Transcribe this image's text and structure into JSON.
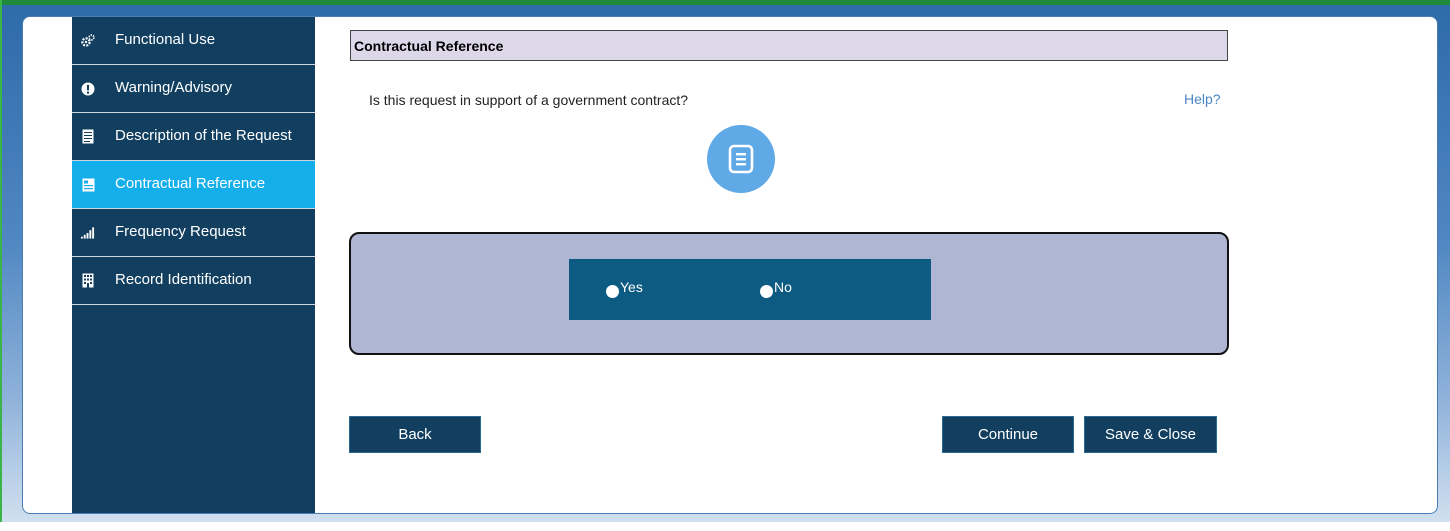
{
  "sidebar": {
    "items": [
      {
        "label": "Functional Use",
        "icon": "gears-icon",
        "active": false
      },
      {
        "label": "Warning/Advisory",
        "icon": "exclamation-icon",
        "active": false
      },
      {
        "label": "Description of the Request",
        "icon": "document-lines-icon",
        "active": false
      },
      {
        "label": "Contractual Reference",
        "icon": "contract-icon",
        "active": true
      },
      {
        "label": "Frequency Request",
        "icon": "signal-bars-icon",
        "active": false
      },
      {
        "label": "Record Identification",
        "icon": "building-icon",
        "active": false
      }
    ]
  },
  "section": {
    "title": "Contractual Reference",
    "question": "Is this request in support of a government contract?",
    "help_label": "Help?",
    "badge_icon": "document-icon"
  },
  "choices": {
    "yes_label": "Yes",
    "no_label": "No"
  },
  "buttons": {
    "back": "Back",
    "continue": "Continue",
    "save_close": "Save & Close"
  },
  "colors": {
    "sidebar_bg": "#123f60",
    "active_item": "#14aeea",
    "header_bg": "#ddd8e9",
    "panel_bg": "#aeb6d3",
    "radio_bar": "#0d5a82",
    "help_link": "#4a86c5",
    "badge": "#5fa9e6"
  }
}
